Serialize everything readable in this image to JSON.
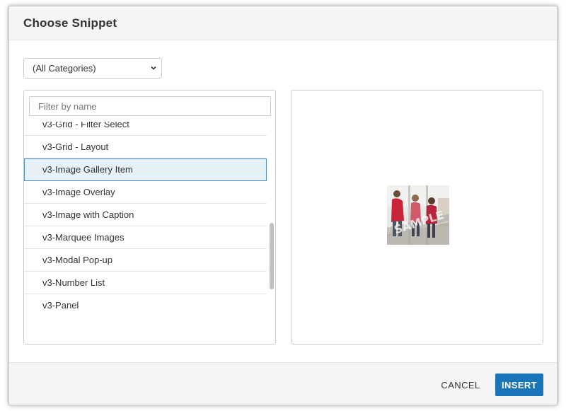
{
  "dialog": {
    "title": "Choose Snippet"
  },
  "category_select": {
    "selected": "(All Categories)",
    "icon": "chevron-down-icon"
  },
  "filter": {
    "placeholder": "Filter by name",
    "value": ""
  },
  "snippets": [
    {
      "label": "v3-Grid - Filter Select",
      "selected": false
    },
    {
      "label": "v3-Grid - Layout",
      "selected": false
    },
    {
      "label": "v3-Image Gallery Item",
      "selected": true
    },
    {
      "label": "v3-Image Overlay",
      "selected": false
    },
    {
      "label": "v3-Image with Caption",
      "selected": false
    },
    {
      "label": "v3-Marquee Images",
      "selected": false
    },
    {
      "label": "v3-Modal Pop-up",
      "selected": false
    },
    {
      "label": "v3-Number List",
      "selected": false
    },
    {
      "label": "v3-Panel",
      "selected": false
    }
  ],
  "preview": {
    "image": "photo-thumbnail-icon"
  },
  "footer": {
    "cancel_label": "CANCEL",
    "insert_label": "INSERT"
  },
  "colors": {
    "primary": "#1a75b8",
    "selected_bg": "#e6f0f7",
    "selected_border": "#4a90c4"
  }
}
